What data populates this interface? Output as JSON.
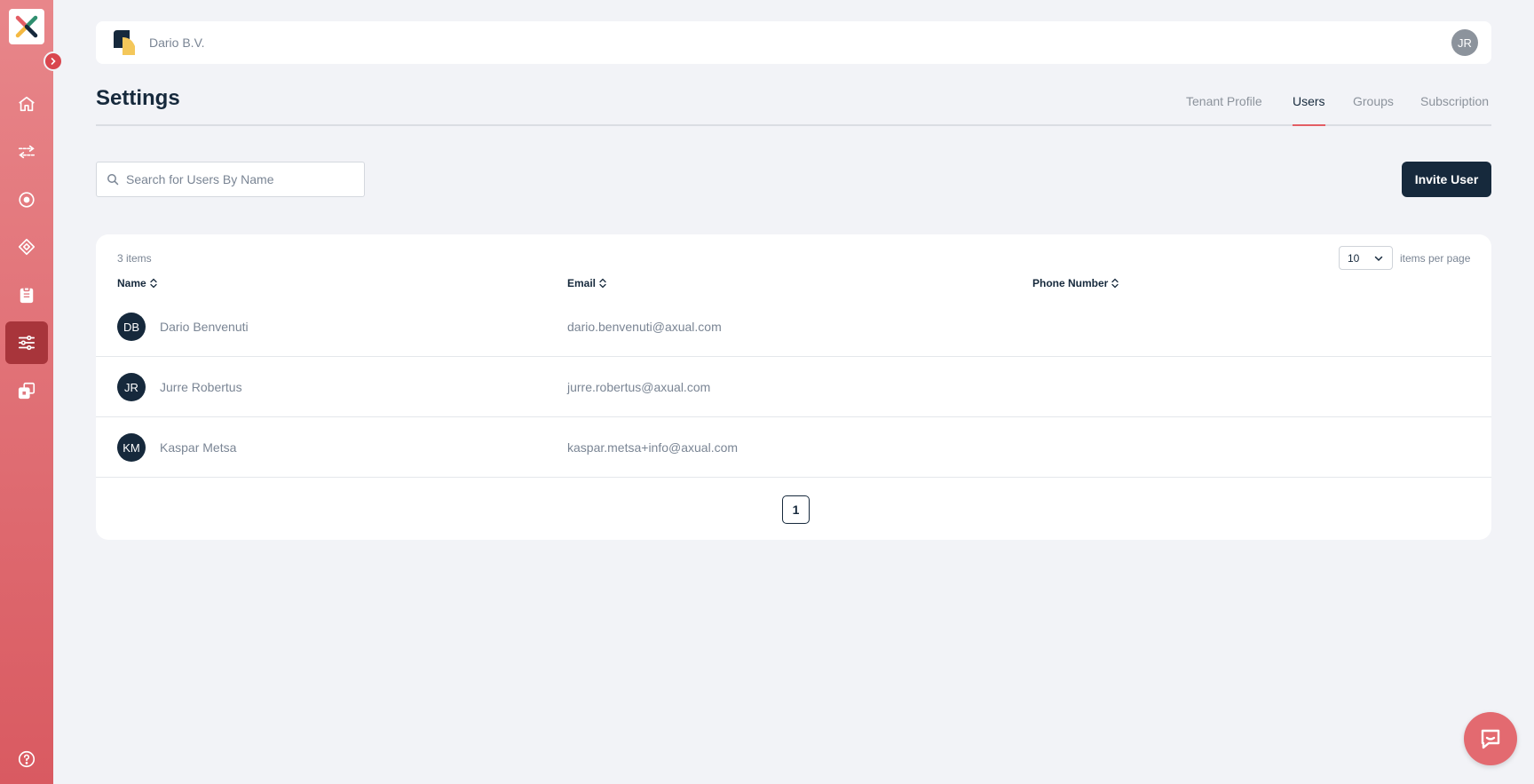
{
  "sidebar": {
    "items": [
      {
        "name": "home"
      },
      {
        "name": "streams"
      },
      {
        "name": "topics"
      },
      {
        "name": "applications"
      },
      {
        "name": "reports"
      },
      {
        "name": "settings",
        "active": true
      },
      {
        "name": "environments"
      }
    ]
  },
  "header": {
    "tenant_name": "Dario B.V.",
    "user_initials": "JR"
  },
  "page": {
    "title": "Settings",
    "tabs": [
      {
        "label": "Tenant Profile"
      },
      {
        "label": "Users",
        "active": true
      },
      {
        "label": "Groups"
      },
      {
        "label": "Subscription"
      }
    ]
  },
  "search": {
    "placeholder": "Search for Users By Name",
    "value": ""
  },
  "invite_button": "Invite User",
  "table": {
    "items_count": "3 items",
    "per_page": "10",
    "per_page_label": "items per page",
    "columns": [
      "Name",
      "Email",
      "Phone Number"
    ],
    "rows": [
      {
        "initials": "DB",
        "name": "Dario Benvenuti",
        "email": "dario.benvenuti@axual.com",
        "phone": ""
      },
      {
        "initials": "JR",
        "name": "Jurre Robertus",
        "email": "jurre.robertus@axual.com",
        "phone": ""
      },
      {
        "initials": "KM",
        "name": "Kaspar Metsa",
        "email": "kaspar.metsa+info@axual.com",
        "phone": ""
      }
    ],
    "current_page": "1"
  },
  "colors": {
    "primary": "#16293c",
    "accent": "#e35d64",
    "sidebar_top": "#e8868a",
    "sidebar_bottom": "#d95a61"
  }
}
